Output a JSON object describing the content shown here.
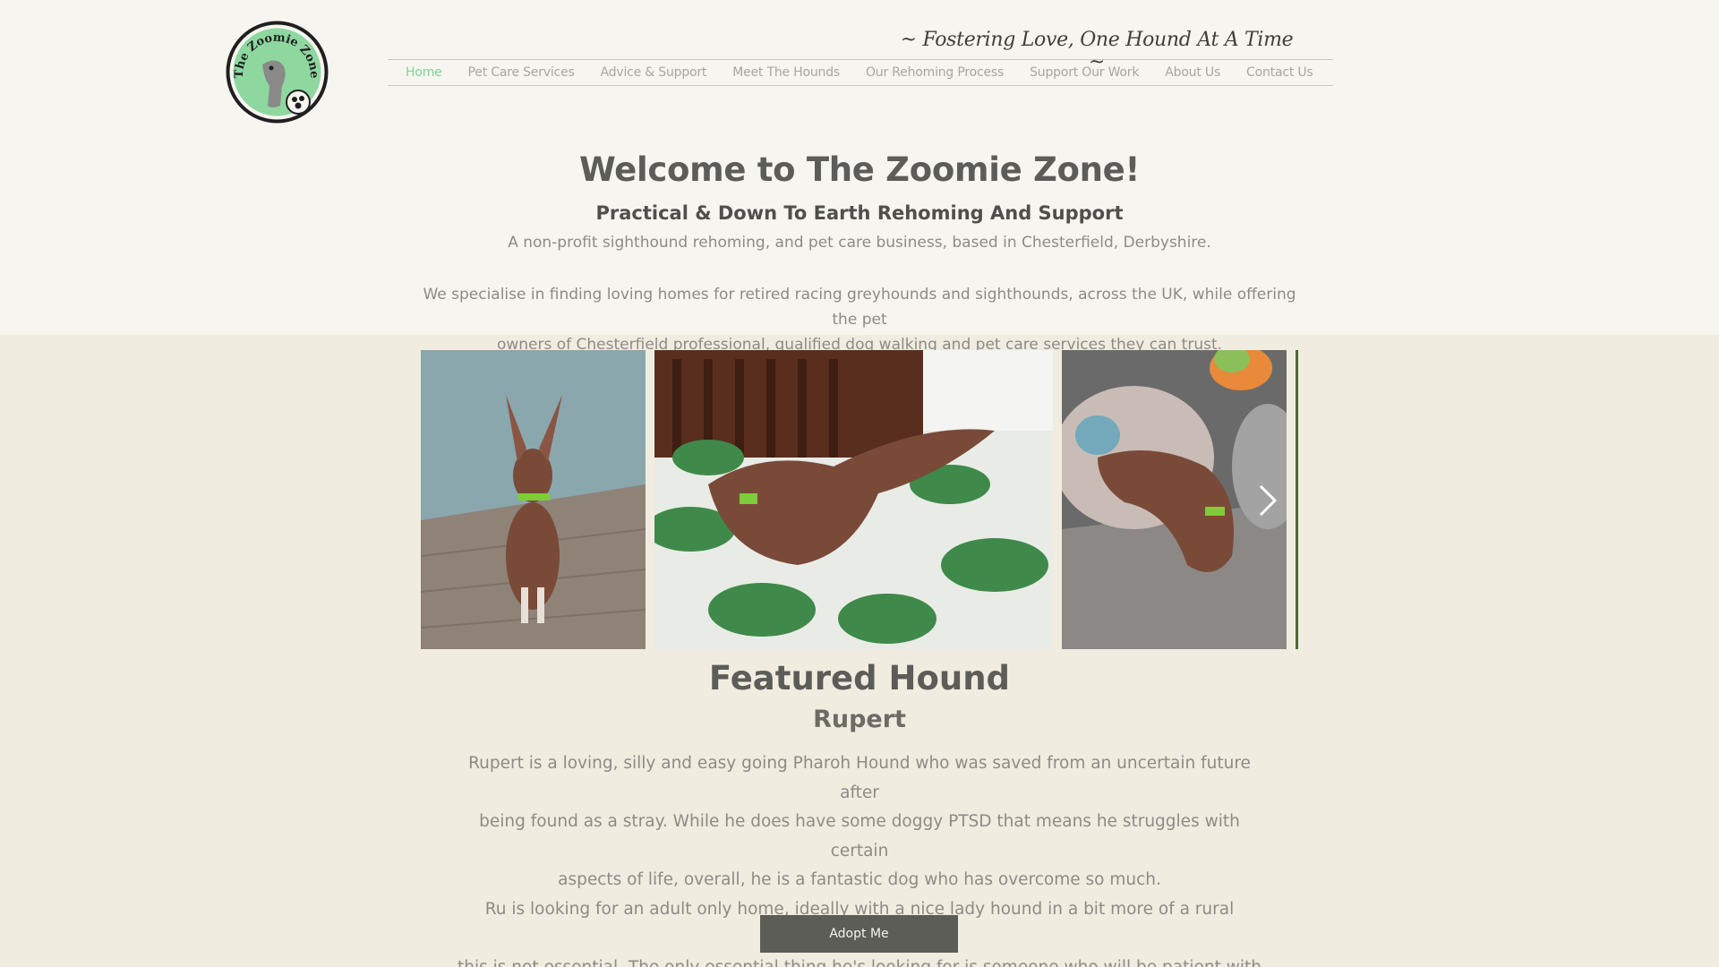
{
  "header": {
    "logo_text": "The Zoomie Zone",
    "tagline": "~ Fostering Love, One Hound At A Time ~"
  },
  "nav": {
    "items": [
      {
        "label": "Home",
        "active": true
      },
      {
        "label": "Pet Care Services",
        "active": false
      },
      {
        "label": "Advice & Support",
        "active": false
      },
      {
        "label": "Meet The Hounds",
        "active": false
      },
      {
        "label": "Our Rehoming Process",
        "active": false
      },
      {
        "label": "Support Our Work",
        "active": false
      },
      {
        "label": "About Us",
        "active": false
      },
      {
        "label": "Contact Us",
        "active": false
      }
    ]
  },
  "welcome": {
    "title": "Welcome to The Zoomie Zone!",
    "subtitle": "Practical & Down To Earth Rehoming And Support",
    "description": "A non-profit sighthound rehoming, and pet care business, based in Chesterfield, Derbyshire.",
    "intro_line1": "We specialise in finding loving homes for retired racing greyhounds and sighthounds, across the UK, while offering the pet",
    "intro_line2": "owners of Chesterfield professional, qualified dog walking and pet care services they can trust."
  },
  "gallery": {
    "next_icon": "chevron-right-icon"
  },
  "featured": {
    "title": "Featured Hound",
    "name": "Rupert",
    "line1": "Rupert is a loving, silly and easy going Pharoh Hound who was saved from an uncertain future after",
    "line2": "being found as a stray.  While he does have some doggy PTSD that means he struggles with certain",
    "line3": "aspects of life, overall, he is a fantastic dog who has overcome so much.",
    "line4": "Ru is looking for an adult only home, ideally with a nice lady hound in a bit more of a rural location, but",
    "line5": "this is not essential.  The only essential thing he's looking for is someone who will be patient with him!",
    "button_label": "Adopt Me"
  },
  "colors": {
    "accent_green": "#7fd497",
    "button_bg": "#5d5d58",
    "page_bg": "#f1ece0",
    "header_bg": "#f7f5f0"
  }
}
